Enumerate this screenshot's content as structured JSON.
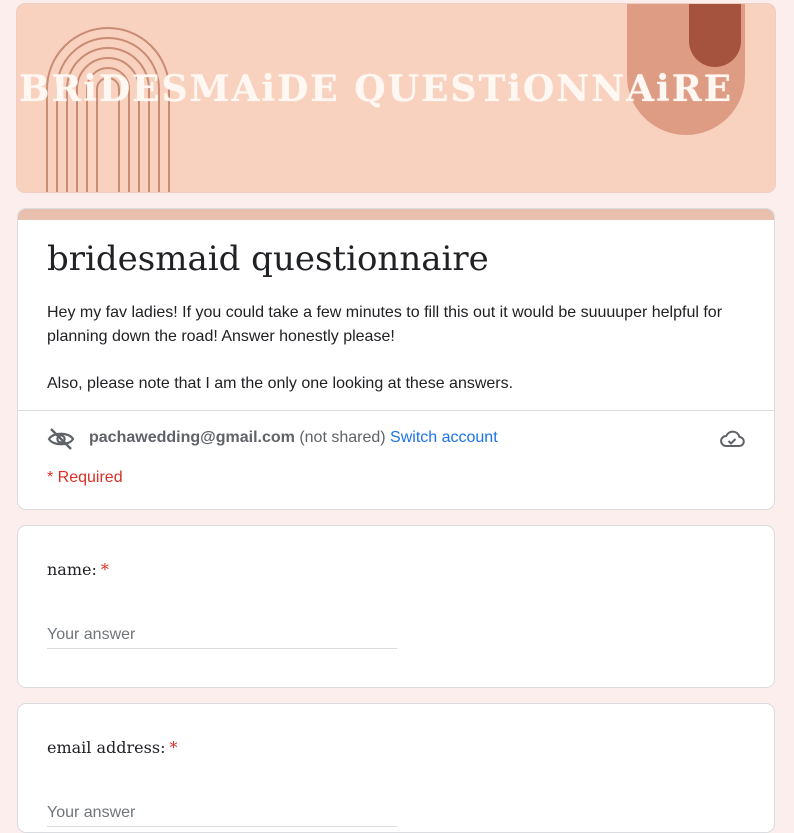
{
  "header": {
    "banner_text": "BRiDESMAiDE QUESTiONNAiRE",
    "colors": {
      "bg": "#f8d2bf",
      "arch": "#c98c74",
      "pill_light": "#df9c84",
      "pill_dark": "#a5533e"
    }
  },
  "form": {
    "title": "bridesmaid questionnaire",
    "description_1": "Hey my fav ladies! If you could take a few minutes to fill this out it would be suuuuper helpful for planning down the road! Answer honestly please!",
    "description_2": "Also, please note that I am the only one looking at these answers.",
    "account_email": "pachawedding@gmail.com",
    "not_shared": "(not shared)",
    "switch_account": "Switch account",
    "required_note": "* Required"
  },
  "questions": [
    {
      "label": "name:",
      "required_mark": "*",
      "placeholder": "Your answer"
    },
    {
      "label": "email address:",
      "required_mark": "*",
      "placeholder": "Your answer"
    }
  ],
  "icons": {
    "hidden": "eye-off-icon",
    "save": "cloud-check-icon"
  }
}
